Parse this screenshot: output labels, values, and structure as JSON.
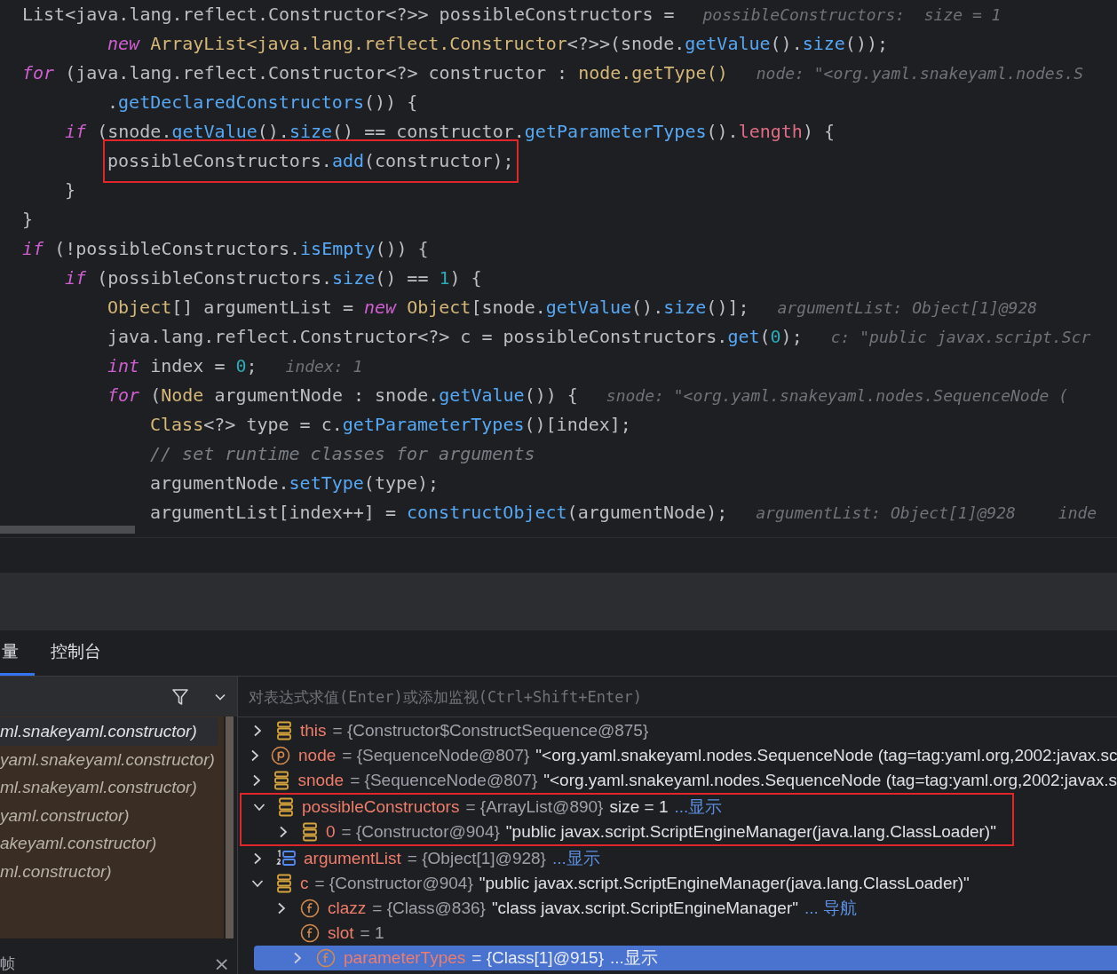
{
  "code": {
    "lines": [
      {
        "boxed": false,
        "tokens": [
          {
            "kind": "plain",
            "text": "List<java.lang.reflect.Constructor<?>> possibleConstructors ="
          }
        ],
        "hints": [
          "possibleConstructors:  size = 1"
        ],
        "continuation": [
          {
            "kind": "keyword",
            "text": "new"
          },
          {
            "kind": "type",
            "text": " ArrayList<java.lang.reflect.Constructor"
          },
          {
            "kind": "plain",
            "text": "<?>>(snode."
          },
          {
            "kind": "method",
            "text": "getValue"
          },
          {
            "kind": "plain",
            "text": "()."
          },
          {
            "kind": "method",
            "text": "size"
          },
          {
            "kind": "plain",
            "text": "());"
          }
        ]
      },
      {
        "boxed": false,
        "tokens": [
          {
            "kind": "keyword",
            "text": "for"
          },
          {
            "kind": "plain",
            "text": " (java.lang.reflect.Constructor<?> constructor : "
          },
          {
            "kind": "type",
            "text": "node.getType()"
          }
        ],
        "hints": [
          "node: \"<org.yaml.snakeyaml.nodes.S"
        ],
        "continuation": [
          {
            "kind": "plain",
            "text": "."
          },
          {
            "kind": "method",
            "text": "getDeclaredConstructors"
          },
          {
            "kind": "plain",
            "text": "()) {"
          }
        ],
        "children": [
          {
            "boxed": false,
            "tokens": [
              {
                "kind": "keyword",
                "text": "if"
              },
              {
                "kind": "plain",
                "text": " (snode."
              },
              {
                "kind": "method",
                "text": "getValue"
              },
              {
                "kind": "plain",
                "text": "()."
              },
              {
                "kind": "method",
                "text": "size"
              },
              {
                "kind": "plain",
                "text": "() == constructor."
              },
              {
                "kind": "method",
                "text": "getParameterTypes"
              },
              {
                "kind": "plain",
                "text": "()."
              },
              {
                "kind": "field",
                "text": "length"
              },
              {
                "kind": "plain",
                "text": ") {"
              }
            ],
            "children": [
              {
                "boxed": true,
                "tokens": [
                  {
                    "kind": "plain",
                    "text": "possibleConstructors."
                  },
                  {
                    "kind": "method",
                    "text": "add"
                  },
                  {
                    "kind": "plain",
                    "text": "(constructor);"
                  }
                ]
              }
            ]
          },
          {
            "boxed": false,
            "tokens": [
              {
                "kind": "plain",
                "text": "}"
              }
            ]
          }
        ]
      },
      {
        "boxed": false,
        "tokens": [
          {
            "kind": "plain",
            "text": "}"
          }
        ]
      },
      {
        "boxed": false,
        "tokens": [
          {
            "kind": "keyword",
            "text": "if"
          },
          {
            "kind": "plain",
            "text": " (!possibleConstructors."
          },
          {
            "kind": "method",
            "text": "isEmpty"
          },
          {
            "kind": "plain",
            "text": "()) {"
          }
        ],
        "children": [
          {
            "boxed": false,
            "tokens": [
              {
                "kind": "keyword",
                "text": "if"
              },
              {
                "kind": "plain",
                "text": " (possibleConstructors."
              },
              {
                "kind": "method",
                "text": "size"
              },
              {
                "kind": "plain",
                "text": "() == "
              },
              {
                "kind": "number",
                "text": "1"
              },
              {
                "kind": "plain",
                "text": ") {"
              }
            ],
            "children": [
              {
                "boxed": false,
                "tokens": [
                  {
                    "kind": "type",
                    "text": "Object"
                  },
                  {
                    "kind": "plain",
                    "text": "[] argumentList = "
                  },
                  {
                    "kind": "keyword",
                    "text": "new"
                  },
                  {
                    "kind": "type",
                    "text": " Object"
                  },
                  {
                    "kind": "plain",
                    "text": "[snode."
                  },
                  {
                    "kind": "method",
                    "text": "getValue"
                  },
                  {
                    "kind": "plain",
                    "text": "()."
                  },
                  {
                    "kind": "method",
                    "text": "size"
                  },
                  {
                    "kind": "plain",
                    "text": "()];"
                  }
                ],
                "hints": [
                  "argumentList: Object[1]@928"
                ]
              },
              {
                "boxed": false,
                "tokens": [
                  {
                    "kind": "plain",
                    "text": "java.lang.reflect.Constructor<?> c = possibleConstructors."
                  },
                  {
                    "kind": "method",
                    "text": "get"
                  },
                  {
                    "kind": "plain",
                    "text": "("
                  },
                  {
                    "kind": "number",
                    "text": "0"
                  },
                  {
                    "kind": "plain",
                    "text": ");"
                  }
                ],
                "hints": [
                  "c: \"public javax.script.Scr"
                ]
              },
              {
                "boxed": false,
                "tokens": [
                  {
                    "kind": "keyword",
                    "text": "int"
                  },
                  {
                    "kind": "plain",
                    "text": " index = "
                  },
                  {
                    "kind": "number",
                    "text": "0"
                  },
                  {
                    "kind": "plain",
                    "text": ";"
                  }
                ],
                "hints": [
                  "index: 1"
                ]
              },
              {
                "boxed": false,
                "tokens": [
                  {
                    "kind": "keyword",
                    "text": "for"
                  },
                  {
                    "kind": "plain",
                    "text": " ("
                  },
                  {
                    "kind": "type",
                    "text": "Node"
                  },
                  {
                    "kind": "plain",
                    "text": " argumentNode : snode."
                  },
                  {
                    "kind": "method",
                    "text": "getValue"
                  },
                  {
                    "kind": "plain",
                    "text": "()) {"
                  }
                ],
                "hints": [
                  "snode: \"<org.yaml.snakeyaml.nodes.SequenceNode ("
                ],
                "children": [
                  {
                    "boxed": false,
                    "tokens": [
                      {
                        "kind": "type",
                        "text": "Class"
                      },
                      {
                        "kind": "plain",
                        "text": "<?> type = c."
                      },
                      {
                        "kind": "method",
                        "text": "getParameterTypes"
                      },
                      {
                        "kind": "plain",
                        "text": "()[index];"
                      }
                    ]
                  },
                  {
                    "boxed": false,
                    "tokens": [
                      {
                        "kind": "comment",
                        "text": "// set runtime classes for arguments"
                      }
                    ]
                  },
                  {
                    "boxed": false,
                    "tokens": [
                      {
                        "kind": "plain",
                        "text": "argumentNode."
                      },
                      {
                        "kind": "method",
                        "text": "setType"
                      },
                      {
                        "kind": "plain",
                        "text": "(type);"
                      }
                    ]
                  },
                  {
                    "boxed": false,
                    "tokens": [
                      {
                        "kind": "plain",
                        "text": "argumentList[index++] = "
                      },
                      {
                        "kind": "method",
                        "text": "constructObject"
                      },
                      {
                        "kind": "plain",
                        "text": "(argumentNode);"
                      }
                    ],
                    "hints": [
                      "argumentList: Object[1]@928",
                      "inde"
                    ]
                  }
                ]
              }
            ]
          }
        ]
      }
    ]
  },
  "debugger": {
    "tabs": [
      {
        "label": "量",
        "selected": true
      },
      {
        "label": "控制台",
        "selected": false
      }
    ],
    "frames": [
      {
        "label": "ml.snakeyaml.constructor)",
        "selected": true
      },
      {
        "label": "yaml.snakeyaml.constructor)",
        "selected": false
      },
      {
        "label": "ml.snakeyaml.constructor)",
        "selected": false
      },
      {
        "label": "yaml.constructor)",
        "selected": false
      },
      {
        "label": "akeyaml.constructor)",
        "selected": false
      },
      {
        "label": "ml.constructor)",
        "selected": false
      }
    ],
    "frames_footer": {
      "label": "帧",
      "close": "×"
    },
    "evaluate_field": {
      "placeholder": "对表达式求值(Enter)或添加监视(Ctrl+Shift+Enter)"
    },
    "variables": [
      {
        "kind": "object",
        "name": "this",
        "ref": "= {Constructor$ConstructSequence@875}",
        "expandable": true,
        "expanded": false,
        "selected": false,
        "boxed": false
      },
      {
        "kind": "parameter",
        "name": "node",
        "ref": "= {SequenceNode@807}",
        "value": "\"<org.yaml.snakeyaml.nodes.SequenceNode (tag=tag:yaml.org,2002:javax.sc",
        "expandable": true,
        "expanded": false,
        "selected": false,
        "boxed": false
      },
      {
        "kind": "object",
        "name": "snode",
        "ref": "= {SequenceNode@807}",
        "value": "\"<org.yaml.snakeyaml.nodes.SequenceNode (tag=tag:yaml.org,2002:javax.s",
        "expandable": true,
        "expanded": false,
        "selected": false,
        "boxed": false
      },
      {
        "kind": "object",
        "name": "possibleConstructors",
        "ref": "= {ArrayList@890}",
        "extra": "size = 1",
        "link": "...显示",
        "expandable": true,
        "expanded": true,
        "selected": false,
        "boxed": true,
        "children": [
          {
            "kind": "object",
            "name": "0",
            "ref": "= {Constructor@904}",
            "value": "\"public javax.script.ScriptEngineManager(java.lang.ClassLoader)\"",
            "expandable": true,
            "expanded": false,
            "selected": false
          }
        ]
      },
      {
        "kind": "array",
        "name": "argumentList",
        "ref": "= {Object[1]@928}",
        "link": "...显示",
        "expandable": true,
        "expanded": false,
        "selected": false,
        "boxed": false
      },
      {
        "kind": "object",
        "name": "c",
        "ref": "= {Constructor@904}",
        "value": "\"public javax.script.ScriptEngineManager(java.lang.ClassLoader)\"",
        "expandable": true,
        "expanded": true,
        "selected": false,
        "boxed": false,
        "children": [
          {
            "kind": "field",
            "name": "clazz",
            "ref": "= {Class@836}",
            "value": "\"class javax.script.ScriptEngineManager\"",
            "link": "... 导航",
            "expandable": true,
            "expanded": false,
            "selected": false
          },
          {
            "kind": "field",
            "name": "slot",
            "ref": "= 1",
            "expandable": false,
            "selected": false
          },
          {
            "kind": "field",
            "name": "parameterTypes",
            "ref": "= {Class[1]@915}",
            "link": "...显示",
            "expandable": true,
            "expanded": false,
            "selected": true
          }
        ]
      }
    ]
  }
}
